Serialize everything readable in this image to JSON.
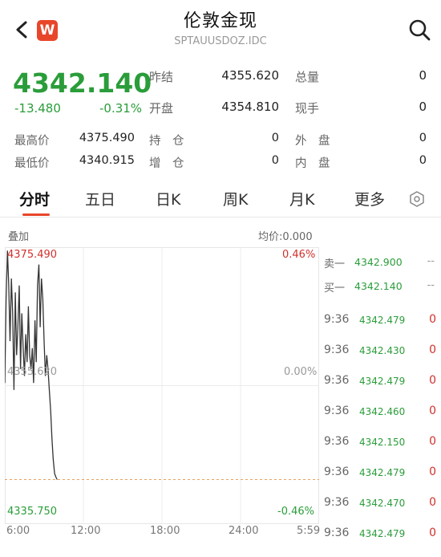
{
  "header": {
    "title": "伦敦金现",
    "code": "SPTAUUSDOZ.IDC",
    "badge": "W"
  },
  "quote": {
    "price": "4342.140",
    "change": "-13.480",
    "change_pct": "-0.31%",
    "stats_row1": [
      {
        "label": "昨结",
        "value": "4355.620"
      },
      {
        "label": "总量",
        "value": "0"
      }
    ],
    "stats_row2": [
      {
        "label": "开盘",
        "value": "4354.810"
      },
      {
        "label": "现手",
        "value": "0"
      }
    ],
    "stats_row3": [
      {
        "label": "最高价",
        "value": "4375.490"
      },
      {
        "label": "持　仓",
        "value": "0"
      },
      {
        "label": "外　盘",
        "value": "0"
      }
    ],
    "stats_row4": [
      {
        "label": "最低价",
        "value": "4340.915"
      },
      {
        "label": "增　仓",
        "value": "0"
      },
      {
        "label": "内　盘",
        "value": "0"
      }
    ]
  },
  "tabs": [
    "分时",
    "五日",
    "日K",
    "周K",
    "月K",
    "更多"
  ],
  "active_tab": "分时",
  "chart": {
    "overlay_label": "叠加",
    "avg_label": "均价:0.000",
    "y_top": "4375.490",
    "y_mid": "4355.620",
    "y_bot": "4335.750",
    "pct_top": "0.46%",
    "pct_mid": "0.00%",
    "pct_bot": "-0.46%",
    "x_labels": [
      "6:00",
      "12:00",
      "18:00",
      "24:00",
      "5:59"
    ],
    "colors": {
      "up": "#d0312d",
      "down": "#2a9d3a",
      "line": "#333333",
      "ref": "#e8a060"
    }
  },
  "chart_data": {
    "type": "line",
    "ylim": [
      4335.75,
      4375.49
    ],
    "x": [
      0,
      1,
      2,
      3,
      4,
      5,
      6,
      7,
      8,
      9,
      10,
      11,
      12,
      13,
      14,
      15,
      16,
      17,
      18,
      19,
      20,
      21,
      22,
      23,
      24,
      25,
      26,
      27,
      28,
      29,
      30,
      31,
      32,
      33,
      34,
      35,
      36,
      37,
      38,
      39,
      40
    ],
    "values": [
      4356,
      4368,
      4375,
      4370,
      4362,
      4371,
      4366,
      4355,
      4369,
      4360,
      4364,
      4370,
      4358,
      4366,
      4361,
      4357,
      4363,
      4359,
      4367,
      4360,
      4358,
      4361,
      4356,
      4365,
      4359,
      4370,
      4373,
      4364,
      4371,
      4368,
      4362,
      4357,
      4360,
      4358,
      4355,
      4352,
      4348,
      4345,
      4343,
      4342.5,
      4342.14
    ],
    "ref": 4355.62,
    "xlabel": "",
    "ylabel": ""
  },
  "orderbook": [
    {
      "name": "卖一",
      "price": "4342.900",
      "qty": "--"
    },
    {
      "name": "买一",
      "price": "4342.140",
      "qty": "--"
    }
  ],
  "ticks": [
    {
      "time": "9:36",
      "price": "4342.479",
      "vol": "0"
    },
    {
      "time": "9:36",
      "price": "4342.430",
      "vol": "0"
    },
    {
      "time": "9:36",
      "price": "4342.479",
      "vol": "0"
    },
    {
      "time": "9:36",
      "price": "4342.460",
      "vol": "0"
    },
    {
      "time": "9:36",
      "price": "4342.150",
      "vol": "0"
    },
    {
      "time": "9:36",
      "price": "4342.479",
      "vol": "0"
    },
    {
      "time": "9:36",
      "price": "4342.470",
      "vol": "0"
    },
    {
      "time": "9:36",
      "price": "4342.479",
      "vol": "0"
    }
  ]
}
